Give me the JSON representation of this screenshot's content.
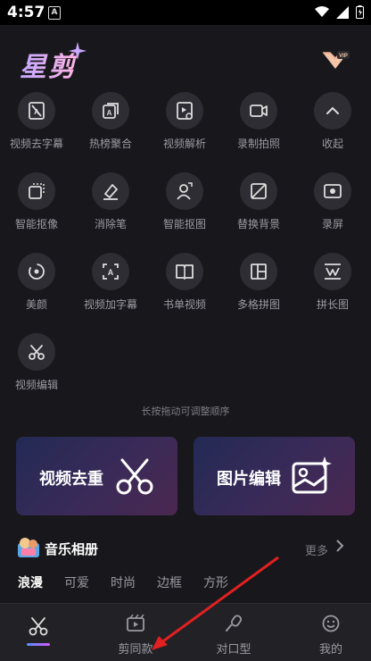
{
  "status": {
    "time": "4:57",
    "notif": "A"
  },
  "app": {
    "logo": "星剪",
    "vip": "VIP"
  },
  "tools": [
    {
      "label": "视频去字幕",
      "icon": "remove-subtitle-icon"
    },
    {
      "label": "热榜聚合",
      "icon": "hot-list-icon"
    },
    {
      "label": "视频解析",
      "icon": "video-parse-icon"
    },
    {
      "label": "录制拍照",
      "icon": "camera-icon"
    },
    {
      "label": "收起",
      "icon": "chevron-up-icon"
    },
    {
      "label": "智能抠像",
      "icon": "smart-cutout-icon"
    },
    {
      "label": "消除笔",
      "icon": "eraser-icon"
    },
    {
      "label": "智能抠图",
      "icon": "person-cutout-icon"
    },
    {
      "label": "替换背景",
      "icon": "replace-bg-icon"
    },
    {
      "label": "录屏",
      "icon": "screen-record-icon"
    },
    {
      "label": "美颜",
      "icon": "beauty-icon"
    },
    {
      "label": "视频加字幕",
      "icon": "add-subtitle-icon"
    },
    {
      "label": "书单视频",
      "icon": "book-icon"
    },
    {
      "label": "多格拼图",
      "icon": "grid-collage-icon"
    },
    {
      "label": "拼长图",
      "icon": "long-image-icon"
    },
    {
      "label": "视频编辑",
      "icon": "scissors-icon"
    }
  ],
  "hint": "长按拖动可调整顺序",
  "cards": [
    {
      "label": "视频去重",
      "icon": "scissors-icon"
    },
    {
      "label": "图片编辑",
      "icon": "image-edit-icon"
    }
  ],
  "music": {
    "title": "音乐相册",
    "more": "更多",
    "tabs": [
      "浪漫",
      "可爱",
      "时尚",
      "边框",
      "方形"
    ]
  },
  "nav": [
    {
      "label": "",
      "icon": "scissors-icon"
    },
    {
      "label": "剪同款",
      "icon": "film-icon"
    },
    {
      "label": "对口型",
      "icon": "microphone-icon"
    },
    {
      "label": "我的",
      "icon": "smile-icon"
    }
  ],
  "colors": {
    "background": "#18181c",
    "tool_bg": "#2d2d33",
    "arrow": "#e32020"
  }
}
